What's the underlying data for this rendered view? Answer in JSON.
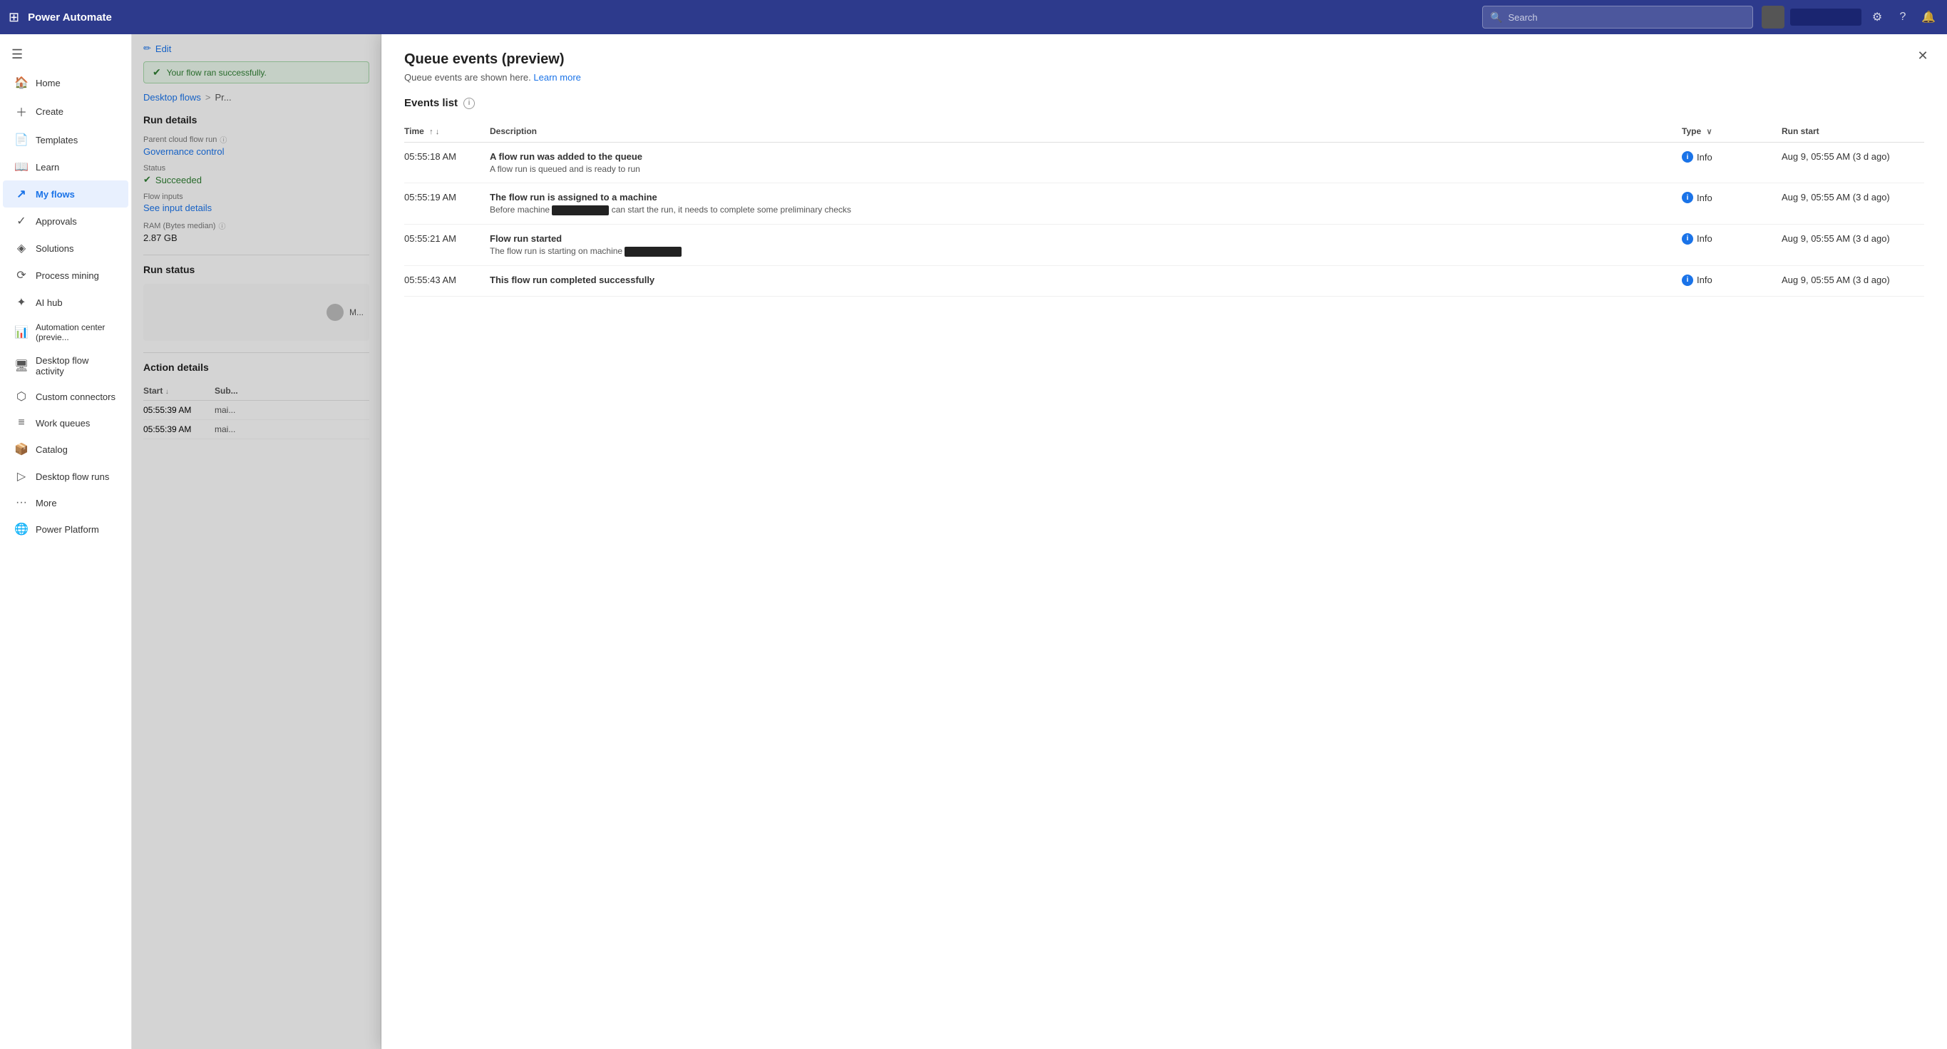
{
  "topbar": {
    "logo": "Power Automate",
    "search_placeholder": "Search",
    "grid_icon": "⊞"
  },
  "sidebar": {
    "hamburger_icon": "☰",
    "items": [
      {
        "id": "home",
        "label": "Home",
        "icon": "🏠",
        "active": false
      },
      {
        "id": "create",
        "label": "Create",
        "icon": "+",
        "active": false
      },
      {
        "id": "templates",
        "label": "Templates",
        "icon": "📄",
        "active": false
      },
      {
        "id": "learn",
        "label": "Learn",
        "icon": "📖",
        "active": false
      },
      {
        "id": "my-flows",
        "label": "My flows",
        "icon": "↗",
        "active": true
      },
      {
        "id": "approvals",
        "label": "Approvals",
        "icon": "✓",
        "active": false
      },
      {
        "id": "solutions",
        "label": "Solutions",
        "icon": "◈",
        "active": false
      },
      {
        "id": "process-mining",
        "label": "Process mining",
        "icon": "⟳",
        "active": false
      },
      {
        "id": "ai-hub",
        "label": "AI hub",
        "icon": "✦",
        "active": false
      },
      {
        "id": "automation-center",
        "label": "Automation center (previe...",
        "icon": "📊",
        "active": false
      },
      {
        "id": "desktop-flow-activity",
        "label": "Desktop flow activity",
        "icon": "🖥",
        "active": false
      },
      {
        "id": "custom-connectors",
        "label": "Custom connectors",
        "icon": "⬡",
        "active": false
      },
      {
        "id": "work-queues",
        "label": "Work queues",
        "icon": "≡",
        "active": false
      },
      {
        "id": "catalog",
        "label": "Catalog",
        "icon": "📦",
        "active": false
      },
      {
        "id": "desktop-flow-runs",
        "label": "Desktop flow runs",
        "icon": "▷",
        "active": false
      },
      {
        "id": "more",
        "label": "More",
        "icon": "···",
        "active": false
      },
      {
        "id": "power-platform",
        "label": "Power Platform",
        "icon": "🌐",
        "active": false
      }
    ]
  },
  "bg_page": {
    "edit_label": "Edit",
    "success_banner": "Your flow ran successfully.",
    "breadcrumb": {
      "desktop_flows": "Desktop flows",
      "separator": ">",
      "current": "Pr..."
    },
    "run_details": {
      "section_title": "Run details",
      "parent_cloud_label": "Parent cloud flow run",
      "governance_link": "Governance control",
      "status_label": "Status",
      "status_value": "Succeeded",
      "flow_inputs_label": "Flow inputs",
      "see_input_link": "See input details",
      "ram_label": "RAM (Bytes median)",
      "ram_value": "2.87 GB"
    },
    "run_status": {
      "section_title": "Run status"
    },
    "action_details": {
      "section_title": "Action details",
      "col_start": "Start",
      "col_sub": "Sub...",
      "rows": [
        {
          "start": "05:55:39 AM",
          "sub": "mai..."
        },
        {
          "start": "05:55:39 AM",
          "sub": "mai..."
        }
      ]
    }
  },
  "panel": {
    "title": "Queue events (preview)",
    "subtitle_text": "Queue events are shown here.",
    "learn_more_label": "Learn more",
    "close_icon": "✕",
    "events_list_label": "Events list",
    "table": {
      "columns": [
        {
          "id": "time",
          "label": "Time",
          "sortable": true
        },
        {
          "id": "description",
          "label": "Description",
          "sortable": false
        },
        {
          "id": "type",
          "label": "Type",
          "filterable": true
        },
        {
          "id": "run_start",
          "label": "Run start",
          "sortable": false
        }
      ],
      "rows": [
        {
          "time": "05:55:18 AM",
          "desc_title": "A flow run was added to the queue",
          "desc_text": "A flow run is queued and is ready to run",
          "type": "Info",
          "run_start": "Aug 9, 05:55 AM (3 d ago)"
        },
        {
          "time": "05:55:19 AM",
          "desc_title": "The flow run is assigned to a machine",
          "desc_text_before": "Before machine",
          "desc_text_redacted": true,
          "desc_text_after": "can start the run, it needs to complete some preliminary checks",
          "type": "Info",
          "run_start": "Aug 9, 05:55 AM (3 d ago)"
        },
        {
          "time": "05:55:21 AM",
          "desc_title": "Flow run started",
          "desc_text_before": "The flow run is starting on machine",
          "desc_text_redacted": true,
          "desc_text_after": "",
          "type": "Info",
          "run_start": "Aug 9, 05:55 AM (3 d ago)"
        },
        {
          "time": "05:55:43 AM",
          "desc_title": "This flow run completed successfully",
          "desc_text": "",
          "type": "Info",
          "run_start": "Aug 9, 05:55 AM (3 d ago)"
        }
      ]
    }
  }
}
